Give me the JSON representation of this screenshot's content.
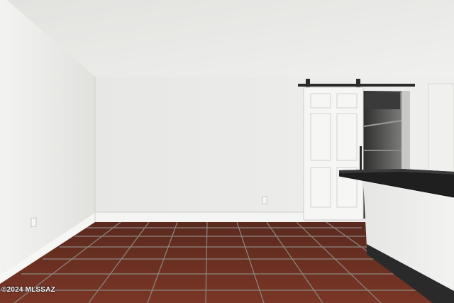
{
  "photo": {
    "watermark": "©2024 MLSSAZ"
  },
  "colors": {
    "ceiling": "#e6e6e3",
    "back_wall": "#eeeeec",
    "left_wall": "#e9e9e7",
    "tile": "#6e3324",
    "grout": "#8a8a84",
    "baseboard": "#f4f4f2",
    "door": "#f5f5f3",
    "barn_rail": "#2b2b2b",
    "counter_top": "#1f1f1f",
    "cabinet_base": "#2a2a2a"
  }
}
